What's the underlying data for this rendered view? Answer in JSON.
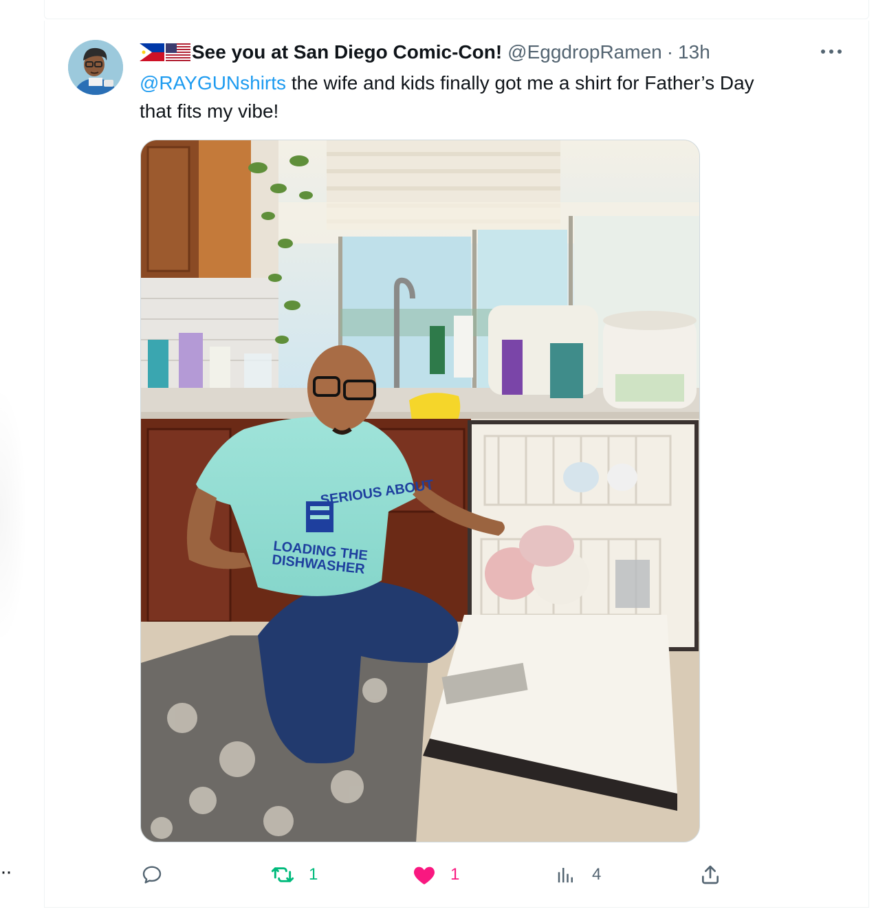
{
  "tweet": {
    "flags": [
      "philippines-flag-icon",
      "usa-flag-icon"
    ],
    "display_name": "See you at San Diego Comic-Con!",
    "handle": "@EggdropRamen",
    "separator": "·",
    "time": "13h",
    "mention": "@RAYGUNshirts",
    "text_line1_rest": " the wife and kids finally got me a shirt for Father’s Day",
    "text_line2": "that fits my vibe!",
    "media_shirt_text": {
      "top": "SERIOUS ABOUT",
      "bottom_line1": "LOADING THE",
      "bottom_line2": "DISHWASHER"
    },
    "more_icon": "more-horizontal-icon"
  },
  "actions": {
    "reply": {
      "icon": "reply-icon",
      "count": ""
    },
    "retweet": {
      "icon": "retweet-icon",
      "count": "1",
      "color": "#00ba7c"
    },
    "like": {
      "icon": "heart-icon",
      "count": "1",
      "color": "#f91880"
    },
    "views": {
      "icon": "views-chart-icon",
      "count": "4"
    },
    "share": {
      "icon": "share-icon",
      "count": ""
    }
  },
  "colors": {
    "link": "#1d9bf0",
    "secondary_text": "#536471",
    "border": "#eff3f4"
  }
}
